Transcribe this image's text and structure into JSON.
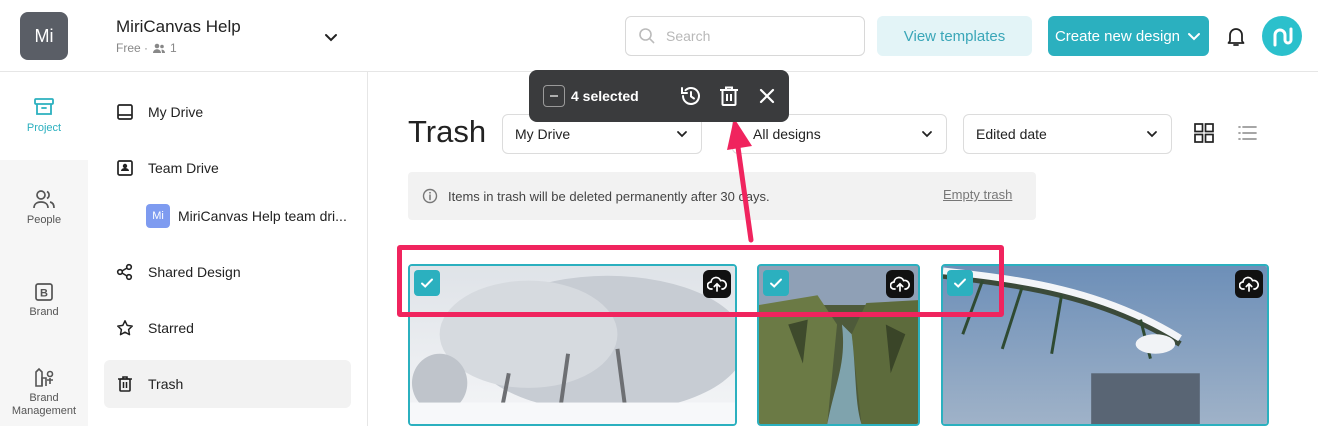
{
  "header": {
    "workspace_initials": "Mi",
    "workspace_name": "MiriCanvas Help",
    "workspace_plan": "Free ·",
    "member_count": "1",
    "search_placeholder": "Search",
    "view_templates_label": "View templates",
    "create_design_label": "Create new design"
  },
  "rail": {
    "items": [
      {
        "label": "Project",
        "icon": "archive-icon"
      },
      {
        "label": "People",
        "icon": "people-icon"
      },
      {
        "label": "Brand",
        "icon": "brand-icon"
      },
      {
        "label": "Brand Management",
        "icon": "brand-management-icon"
      }
    ]
  },
  "sidebar": {
    "items": [
      {
        "label": "My Drive",
        "icon": "drive-icon"
      },
      {
        "label": "Team Drive",
        "icon": "team-drive-icon"
      },
      {
        "label": "MiriCanvas Help team dri...",
        "icon": "team-avatar",
        "avatar": "Mi"
      },
      {
        "label": "Shared Design",
        "icon": "share-icon"
      },
      {
        "label": "Starred",
        "icon": "star-icon"
      },
      {
        "label": "Trash",
        "icon": "trash-icon"
      }
    ]
  },
  "main": {
    "title": "Trash",
    "filter_location": "My Drive",
    "filter_type": "All designs",
    "filter_sort": "Edited date",
    "notice_text": "Items in trash will be deleted permanently after 30 days.",
    "empty_trash_label": "Empty trash"
  },
  "selection_bar": {
    "selected_text": "4 selected"
  },
  "colors": {
    "accent": "#2bb0bf",
    "annotation": "#f0245e",
    "toolbar_bg": "#3a3b3d"
  }
}
